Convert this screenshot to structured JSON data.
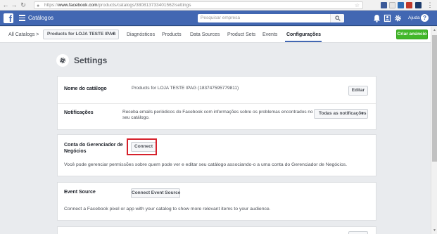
{
  "browser": {
    "url_prefix": "https://",
    "url_host": "www.facebook.com",
    "url_path": "/products/catalogs/380813733401562/settings"
  },
  "topbar": {
    "title": "Catálogos",
    "search_placeholder": "Pesquisar empresa",
    "help_label": "Ajuda",
    "brand_color": "#4267b2"
  },
  "subnav": {
    "breadcrumb": "All Catalogs >",
    "catalog_select": "Products for LOJA TESTE IPAG",
    "tabs": [
      "Diagnósticos",
      "Products",
      "Data Sources",
      "Product Sets",
      "Events",
      "Configurações"
    ],
    "active_tab": "Configurações",
    "create_ad": "Criar anúncio"
  },
  "page": {
    "title": "Settings",
    "catalog_name": {
      "label": "Nome do catálogo",
      "value": "Products for LOJA TESTE IPAG (183747595779811)",
      "button": "Editar"
    },
    "notifications": {
      "label": "Notificações",
      "value_line1": "Receba emails periódicos do Facebook com informações sobre os problemas encontrados no",
      "value_line2": "seu catálogo.",
      "dropdown": "Todas as notificações"
    },
    "business_manager": {
      "label_line1": "Conta do Gerenciador de",
      "label_line2": "Negócios",
      "button": "Connect",
      "description": "Você pode gerenciar permissões sobre quem pode ver e editar seu catálogo associando-o a uma conta do Gerenciador de Negócios."
    },
    "event_source": {
      "label": "Event Source",
      "button": "Connect Event Source",
      "description": "Connect a Facebook pixel or app with your catalog to show more relevant items to your audience."
    }
  }
}
